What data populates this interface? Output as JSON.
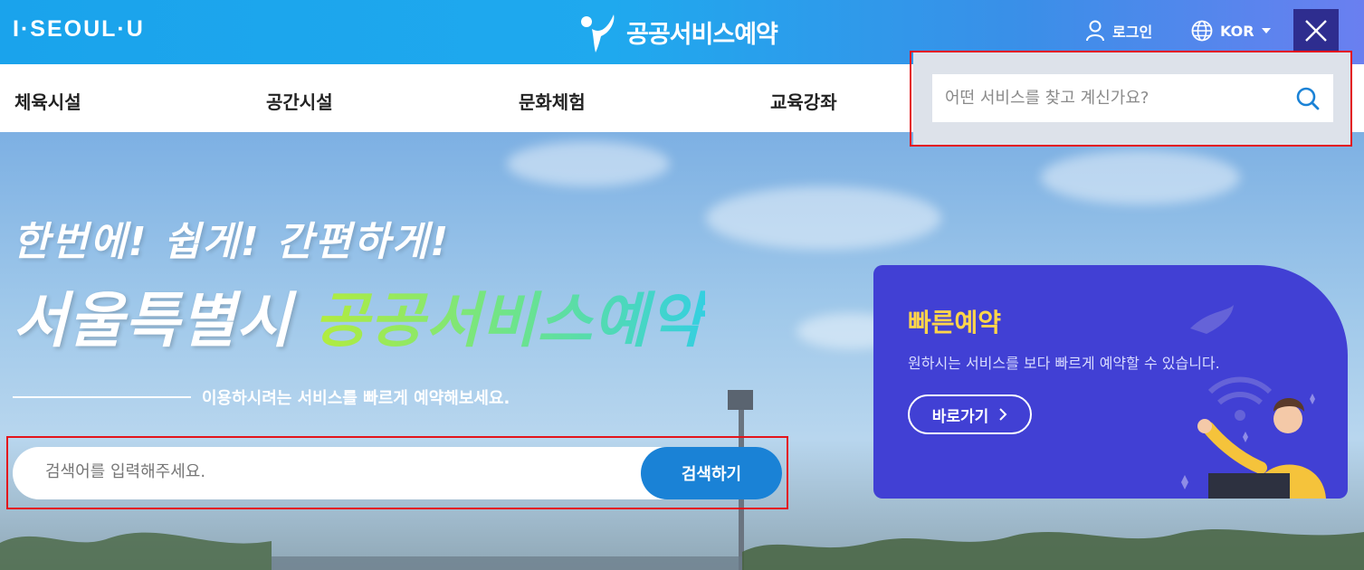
{
  "header": {
    "logo_text": "I·SEOUL·U",
    "brand_text": "공공서비스예약",
    "login_label": "로그인",
    "language_label": "KOR"
  },
  "nav": {
    "items": [
      {
        "label": "체육시설"
      },
      {
        "label": "공간시설"
      },
      {
        "label": "문화체험"
      },
      {
        "label": "교육강좌"
      }
    ]
  },
  "top_search": {
    "placeholder": "어떤 서비스를 찾고 계신가요?"
  },
  "hero": {
    "tagline_line1": "한번에! 쉽게! 간편하게!",
    "tagline_white": "서울특별시 ",
    "tagline_highlight": "공공서비스예약",
    "subline": "이용하시려는 서비스를 빠르게 예약해보세요.",
    "search_placeholder": "검색어를 입력해주세요.",
    "search_button": "검색하기"
  },
  "quick_reserve": {
    "title": "빠른예약",
    "description": "원하시는 서비스를 보다 빠르게 예약할 수 있습니다.",
    "button_label": "바로가기"
  },
  "colors": {
    "header_gradient_start": "#1aa3ec",
    "close_button": "#2e2d8f",
    "quick_card": "#4140d4",
    "quick_title": "#ffd54a",
    "search_button": "#1a82d6",
    "highlight_box": "#e3141b"
  }
}
